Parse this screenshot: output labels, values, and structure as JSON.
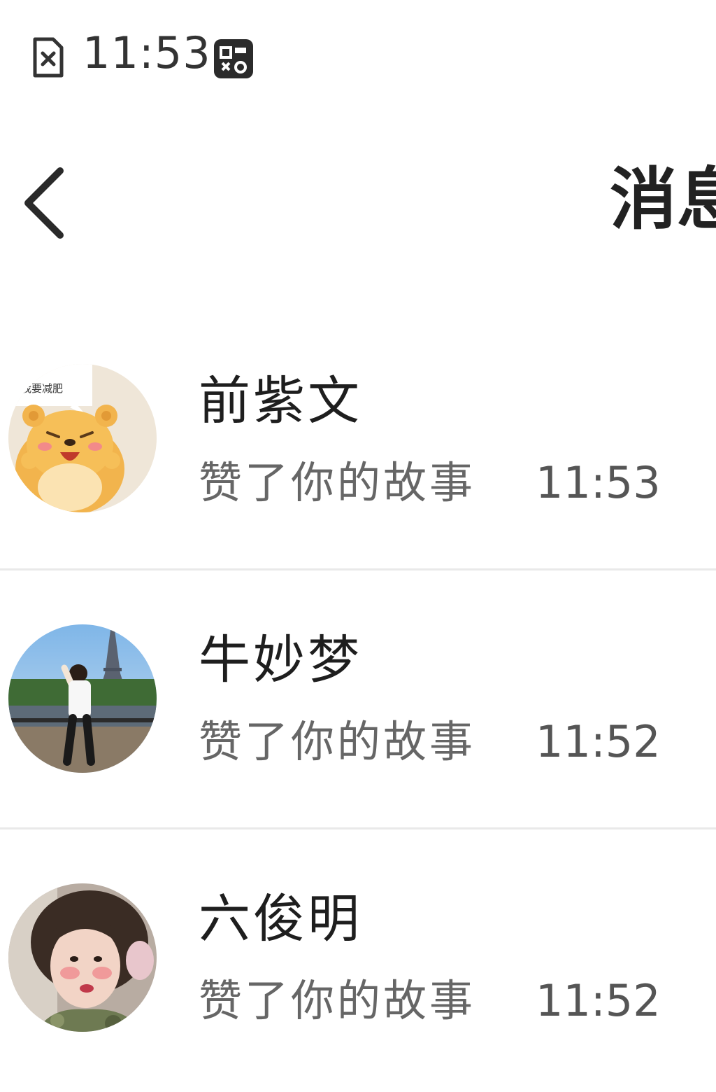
{
  "status_bar": {
    "time": "11:53",
    "sim_icon": "sim-card-x-icon",
    "app_icon": "app-notification-icon"
  },
  "header": {
    "back_icon": "chevron-left-icon",
    "title": "消息"
  },
  "messages": [
    {
      "name": "前紫文",
      "action": "赞了你的故事",
      "time": "11:53",
      "avatar_caption": "我要减肥"
    },
    {
      "name": "牛妙梦",
      "action": "赞了你的故事",
      "time": "11:52"
    },
    {
      "name": "六俊明",
      "action": "赞了你的故事",
      "time": "11:52"
    }
  ],
  "colors": {
    "background": "#ffffff",
    "text_primary": "#1e1e1e",
    "text_secondary": "#666666",
    "divider": "#e9e9e9"
  }
}
